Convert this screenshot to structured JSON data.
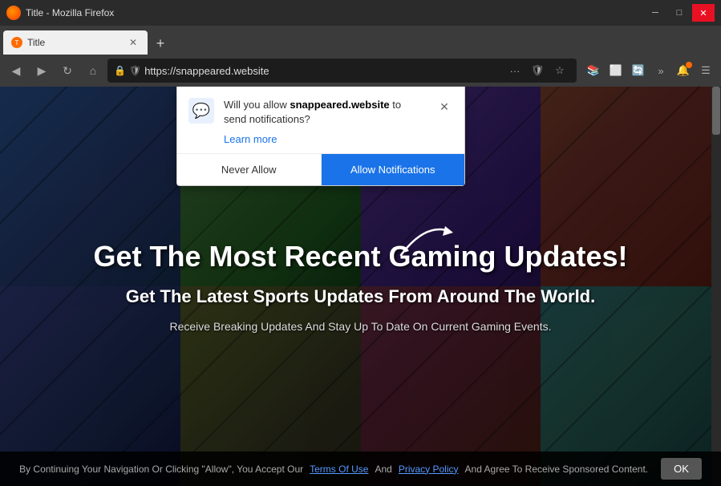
{
  "window": {
    "title": "Title - Mozilla Firefox",
    "tab_label": "Title",
    "url": "https://snappeared.website"
  },
  "nav": {
    "back_icon": "◀",
    "forward_icon": "▶",
    "reload_icon": "↻",
    "home_icon": "⌂"
  },
  "popup": {
    "question": "Will you allow ",
    "site": "snappeared.website",
    "question_end": " to send notifications?",
    "learn_more": "Learn more",
    "never_allow": "Never Allow",
    "allow_notifications": "Allow Notifications",
    "close_icon": "✕"
  },
  "content": {
    "heading": "Get The Most Recent Gaming Updates!",
    "subheading": "Get The Latest Sports Updates From Around The World.",
    "description": "Receive Breaking Updates And Stay Up To Date On Current Gaming Events."
  },
  "footer": {
    "text1": "By Continuing Your Navigation Or Clicking \"Allow\", You Accept Our",
    "link1": "Terms Of Use",
    "text2": "And",
    "link2": "Privacy Policy",
    "text3": "And Agree To Receive Sponsored Content.",
    "ok_button": "OK"
  }
}
